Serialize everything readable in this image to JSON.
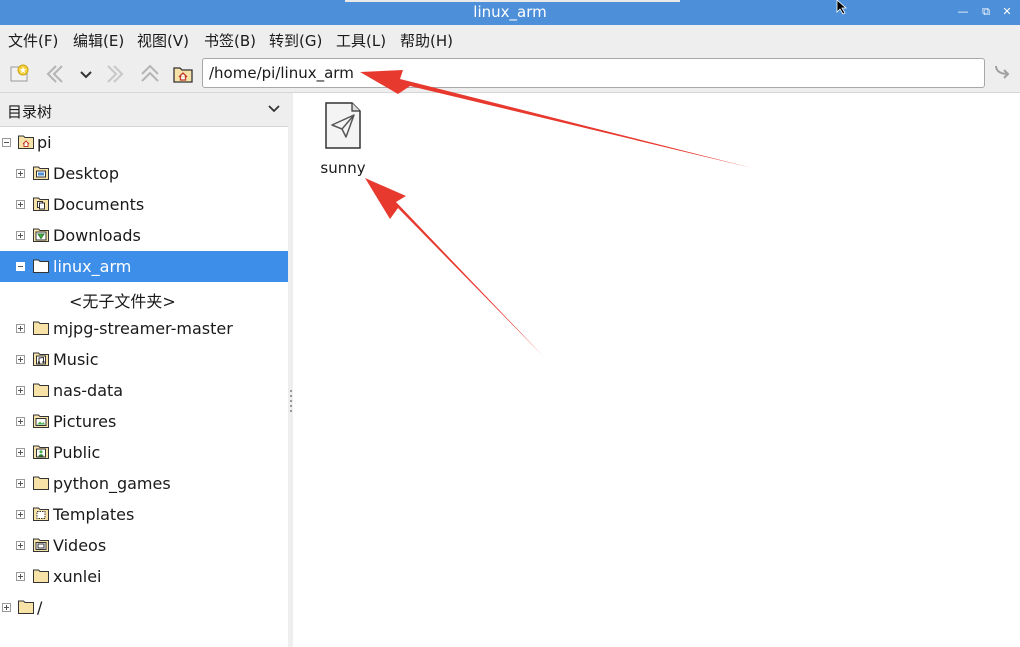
{
  "window": {
    "title": "linux_arm"
  },
  "menu": [
    {
      "label": "文件(F)"
    },
    {
      "label": "编辑(E)"
    },
    {
      "label": "视图(V)"
    },
    {
      "label": "书签(B)"
    },
    {
      "label": "转到(G)"
    },
    {
      "label": "工具(L)"
    },
    {
      "label": "帮助(H)"
    }
  ],
  "toolbar": {
    "address": "/home/pi/linux_arm"
  },
  "side_pane": {
    "title": "目录树",
    "items": [
      {
        "label": "pi",
        "icon": "home-folder-icon",
        "expanded": true
      },
      {
        "label": "Desktop",
        "icon": "desktop-folder-icon"
      },
      {
        "label": "Documents",
        "icon": "documents-folder-icon"
      },
      {
        "label": "Downloads",
        "icon": "downloads-folder-icon"
      },
      {
        "label": "linux_arm",
        "icon": "folder-icon",
        "selected": true,
        "expanded": true
      },
      {
        "label": "<无子文件夹>"
      },
      {
        "label": "mjpg-streamer-master",
        "icon": "folder-icon"
      },
      {
        "label": "Music",
        "icon": "music-folder-icon"
      },
      {
        "label": "nas-data",
        "icon": "folder-icon"
      },
      {
        "label": "Pictures",
        "icon": "pictures-folder-icon"
      },
      {
        "label": "Public",
        "icon": "public-folder-icon"
      },
      {
        "label": "python_games",
        "icon": "folder-icon"
      },
      {
        "label": "Templates",
        "icon": "templates-folder-icon"
      },
      {
        "label": "Videos",
        "icon": "videos-folder-icon"
      },
      {
        "label": "xunlei",
        "icon": "folder-icon"
      },
      {
        "label": "/",
        "icon": "folder-icon"
      }
    ]
  },
  "files": [
    {
      "name": "sunny",
      "icon": "executable-file-icon"
    }
  ],
  "colors": {
    "titlebar": "#4d8fd9",
    "selection": "#3d8ee8",
    "annotation_arrow": "#e8392f",
    "folder": "#f7e2a8"
  }
}
